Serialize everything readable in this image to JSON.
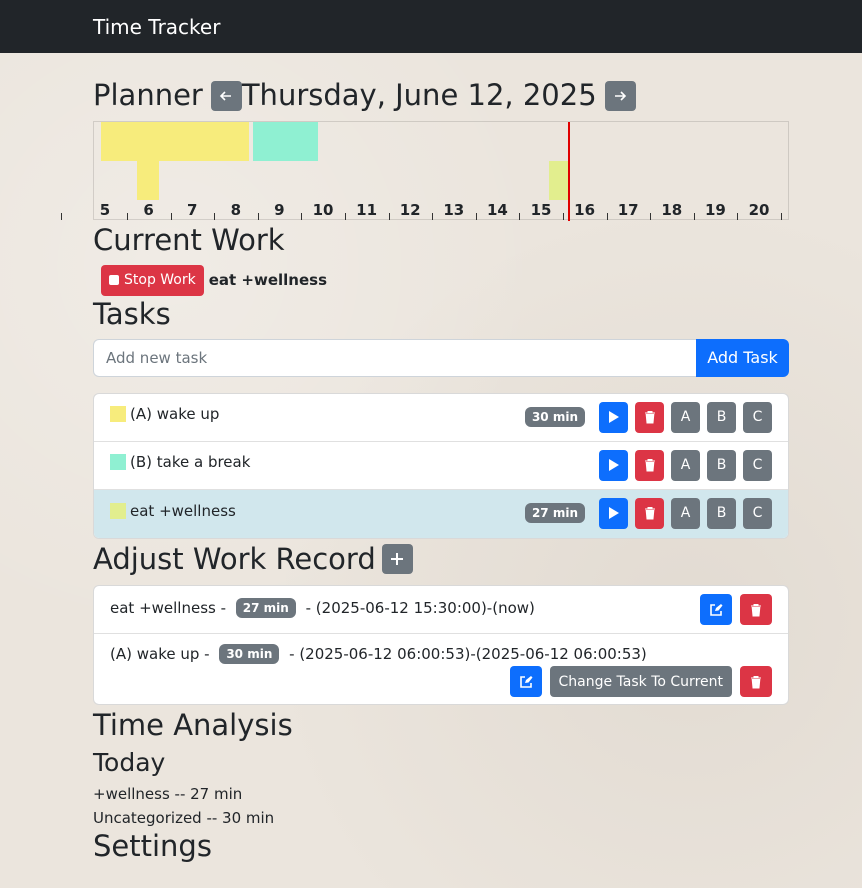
{
  "navbar": {
    "brand": "Time Tracker"
  },
  "planner": {
    "title": "Planner",
    "date": "Thursday, June 12, 2025",
    "prev_icon": "arrow-left-icon",
    "next_icon": "arrow-right-icon",
    "hours": [
      "5",
      "6",
      "7",
      "8",
      "9",
      "10",
      "11",
      "12",
      "13",
      "14",
      "15",
      "16",
      "17",
      "18",
      "19",
      "20"
    ],
    "colors": {
      "yellow": "#f7ec7c",
      "teal": "#8ff0d2",
      "lime": "#e2ee8e",
      "now": "#e00000"
    }
  },
  "current_work": {
    "title": "Current Work",
    "stop_label": "Stop Work",
    "task": "eat +wellness"
  },
  "tasks": {
    "title": "Tasks",
    "input_placeholder": "Add new task",
    "add_label": "Add Task",
    "items": [
      {
        "label": "(A) wake up",
        "badge": "30 min",
        "color": "#f7ec7c",
        "active": false
      },
      {
        "label": "(B) take a break",
        "badge": "",
        "color": "#8ff0d2",
        "active": false
      },
      {
        "label": "eat +wellness",
        "badge": "27 min",
        "color": "#e2ee8e",
        "active": true
      }
    ],
    "priority_labels": [
      "A",
      "B",
      "C"
    ]
  },
  "adjust": {
    "title": "Adjust Work Record",
    "add_icon": "plus-icon",
    "records": [
      {
        "task": "eat +wellness",
        "sep1": " - ",
        "badge": "27 min",
        "sep2": " - ",
        "range": "(2025-06-12 15:30:00)-(now)"
      },
      {
        "task": "(A) wake up",
        "sep1": " - ",
        "badge": "30 min",
        "sep2": " - ",
        "range": "(2025-06-12 06:00:53)-(2025-06-12 06:00:53)",
        "change_label": "Change Task To Current"
      }
    ]
  },
  "analysis": {
    "title": "Time Analysis",
    "today_title": "Today",
    "lines": [
      "+wellness -- 27 min",
      "Uncategorized -- 30 min"
    ]
  },
  "settings": {
    "title": "Settings"
  }
}
